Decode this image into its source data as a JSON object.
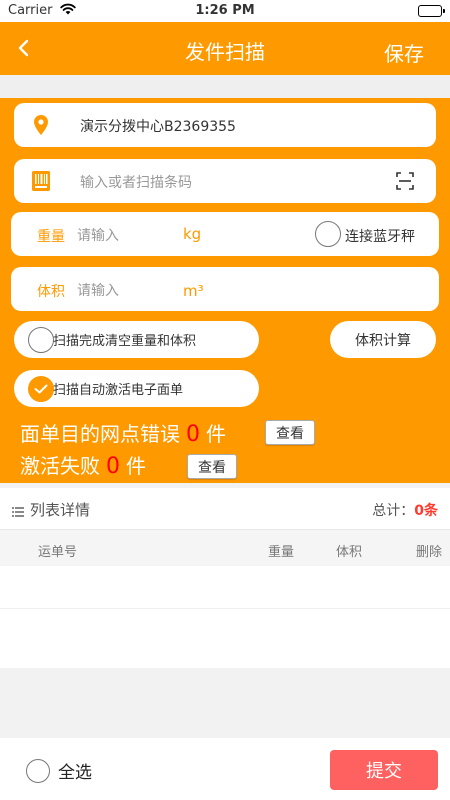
{
  "status_bar": {
    "carrier": "Carrier",
    "time": "1:26 PM"
  },
  "navbar": {
    "title": "发件扫描",
    "save_label": "保存",
    "back_icon": "chevron-left-icon"
  },
  "form": {
    "location": {
      "icon": "location-pin-icon",
      "value": "演示分拨中心B2369355"
    },
    "barcode": {
      "icon": "barcode-icon",
      "placeholder": "输入或者扫描条码",
      "scan_icon": "scan-frame-icon"
    },
    "weight": {
      "label": "重量",
      "placeholder": "请输入",
      "unit": "kg",
      "bluetooth_label": "连接蓝牙秤",
      "bluetooth_checked": false
    },
    "volume": {
      "label": "体积",
      "placeholder": "请输入",
      "unit": "m³"
    },
    "clear_after_scan": {
      "label": "扫描完成清空重量和体积",
      "checked": false
    },
    "volume_calc_label": "体积计算",
    "auto_activate": {
      "label": "扫描自动激活电子面单",
      "checked": true
    },
    "error_stat": {
      "prefix": "面单目的网点错误",
      "count": "0",
      "suffix": "件",
      "view_label": "查看"
    },
    "fail_stat": {
      "prefix": "激活失败",
      "count": "0",
      "suffix": "件",
      "view_label": "查看"
    }
  },
  "list": {
    "icon": "list-icon",
    "title": "列表详情",
    "total_label": "总计：",
    "total_count": "0条",
    "columns": [
      "运单号",
      "重量",
      "体积",
      "删除"
    ]
  },
  "bottom": {
    "select_all_label": "全选",
    "submit_label": "提交"
  },
  "colors": {
    "accent": "#ff9900",
    "submit": "#ff6060",
    "danger": "#ff0000"
  }
}
